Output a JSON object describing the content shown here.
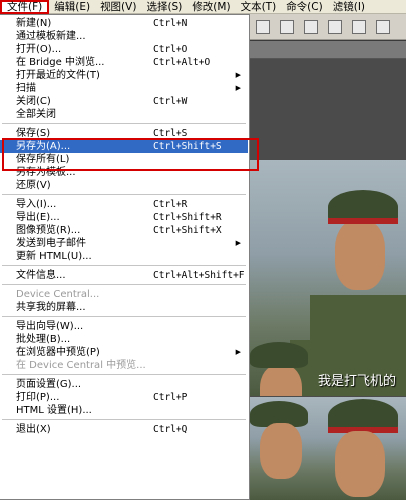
{
  "menubar": [
    {
      "label": "文件(F)",
      "active": true
    },
    {
      "label": "编辑(E)"
    },
    {
      "label": "视图(V)"
    },
    {
      "label": "选择(S)"
    },
    {
      "label": "修改(M)"
    },
    {
      "label": "文本(T)"
    },
    {
      "label": "命令(C)"
    },
    {
      "label": "滤镜(I)"
    }
  ],
  "menu": {
    "items": [
      {
        "label": "新建(N)",
        "shortcut": "Ctrl+N"
      },
      {
        "label": "通过模板新建..."
      },
      {
        "label": "打开(O)...",
        "shortcut": "Ctrl+O"
      },
      {
        "label": "在 Bridge 中浏览...",
        "shortcut": "Ctrl+Alt+O"
      },
      {
        "label": "打开最近的文件(T)",
        "submenu": true
      },
      {
        "label": "扫描",
        "submenu": true
      },
      {
        "label": "关闭(C)",
        "shortcut": "Ctrl+W"
      },
      {
        "label": "全部关闭"
      },
      {
        "separator": true
      },
      {
        "label": "保存(S)",
        "shortcut": "Ctrl+S"
      },
      {
        "label": "另存为(A)...",
        "shortcut": "Ctrl+Shift+S",
        "selected": true
      },
      {
        "label": "保存所有(L)"
      },
      {
        "label": "另存为模板..."
      },
      {
        "label": "还原(V)"
      },
      {
        "separator": true
      },
      {
        "label": "导入(I)...",
        "shortcut": "Ctrl+R"
      },
      {
        "label": "导出(E)...",
        "shortcut": "Ctrl+Shift+R"
      },
      {
        "label": "图像预览(R)...",
        "shortcut": "Ctrl+Shift+X"
      },
      {
        "label": "发送到电子邮件",
        "submenu": true
      },
      {
        "label": "更新 HTML(U)..."
      },
      {
        "separator": true
      },
      {
        "label": "文件信息...",
        "shortcut": "Ctrl+Alt+Shift+F"
      },
      {
        "separator": true
      },
      {
        "label": "Device Central...",
        "disabled": true
      },
      {
        "label": "共享我的屏幕..."
      },
      {
        "separator": true
      },
      {
        "label": "导出向导(W)..."
      },
      {
        "label": "批处理(B)..."
      },
      {
        "label": "在浏览器中预览(P)",
        "submenu": true
      },
      {
        "label": "在 Device Central 中预览...",
        "disabled": true
      },
      {
        "separator": true
      },
      {
        "label": "页面设置(G)..."
      },
      {
        "label": "打印(P)...",
        "shortcut": "Ctrl+P"
      },
      {
        "label": "HTML 设置(H)..."
      },
      {
        "separator": true
      },
      {
        "label": "退出(X)",
        "shortcut": "Ctrl+Q"
      }
    ]
  },
  "canvas": {
    "subtitle": "我是打飞机的"
  },
  "colors": {
    "highlight": "#316ac5",
    "annotation_red": "#d40000",
    "menu_bg": "#ffffff",
    "menubar_bg": "#ece9d8"
  }
}
